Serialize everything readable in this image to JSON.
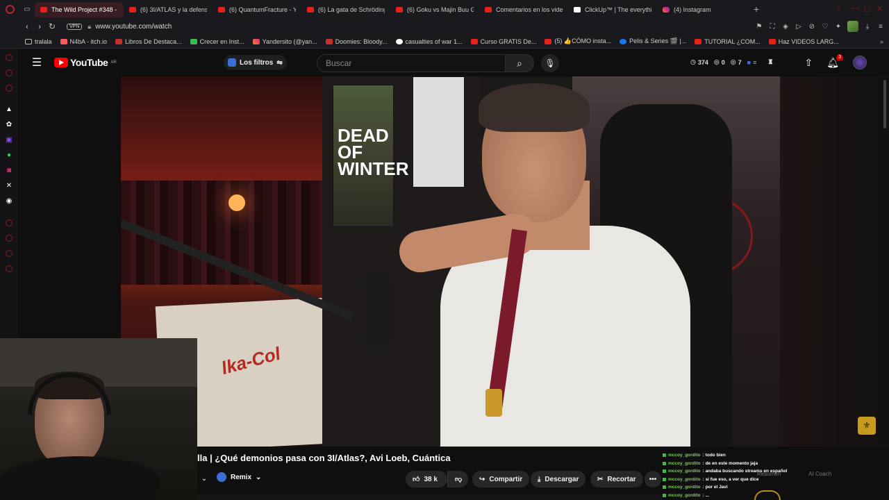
{
  "browser": {
    "tabs": [
      {
        "title": "The Wild Project #348 - J",
        "favicon": "youtube-icon",
        "active": true
      },
      {
        "title": "(6) 3I/ATLAS y la defensa",
        "favicon": "youtube-icon"
      },
      {
        "title": "(6) QuantumFracture - Yo",
        "favicon": "youtube-icon"
      },
      {
        "title": "(6) La gata de Schrödinge",
        "favicon": "youtube-icon"
      },
      {
        "title": "(6) Goku vs Majin Buu Go",
        "favicon": "youtube-icon"
      },
      {
        "title": "Comentarios en los videc",
        "favicon": "youtube-icon"
      },
      {
        "title": "ClickUp™ | The everything",
        "favicon": "clickup-icon"
      },
      {
        "title": "(4) Instagram",
        "favicon": "instagram-icon"
      }
    ],
    "new_tab": "+",
    "vpn_label": "VPN",
    "url": "www.youtube.com/watch",
    "bookmarks": [
      {
        "label": "tralala",
        "icon": "folder-icon"
      },
      {
        "label": "N4bA - itch.io",
        "icon": "itch-icon"
      },
      {
        "label": "Libros De Destaca...",
        "icon": "book-icon"
      },
      {
        "label": "Crecer en Inst...",
        "icon": "check-icon"
      },
      {
        "label": "Yandersito (@yan...",
        "icon": "instagram-icon"
      },
      {
        "label": "Doomies: Bloody...",
        "icon": "doomies-icon"
      },
      {
        "label": "casualties of war 1...",
        "icon": "google-icon"
      },
      {
        "label": "Curso GRATIS De...",
        "icon": "youtube-icon"
      },
      {
        "label": "(5) 👍CÓMO insta...",
        "icon": "youtube-icon"
      },
      {
        "label": "Pelis & Series 🎬 |...",
        "icon": "meta-icon"
      },
      {
        "label": "TUTORIAL ¿COM...",
        "icon": "youtube-icon"
      },
      {
        "label": "Haz VIDEOS LARG...",
        "icon": "youtube-icon"
      }
    ]
  },
  "youtube": {
    "logo_text": "YouTube",
    "region": "AR",
    "filters_label": "Los filtros",
    "search_placeholder": "Buscar",
    "stats": {
      "views": "374",
      "hidden": "0",
      "watchers": "7"
    },
    "notifications_count": "3",
    "video_title": "lla | ¿Qué demonios pasa con 3I/Atlas?, Avi Loeb, Cuántica",
    "remix_label": "Remix",
    "likes": "38 k",
    "share_label": "Compartir",
    "download_label": "Descargar",
    "clip_label": "Recortar",
    "video_poster_text": "DEAD OF WINTER",
    "video_sign_text": "lka-Col"
  },
  "chat": {
    "messages": [
      {
        "user": "mccoy_gordito",
        "text": ": todo bien"
      },
      {
        "user": "mccoy_gordito",
        "text": ": de en este momento jaja"
      },
      {
        "user": "mccoy_gordito",
        "text": ": andaba buscando streams en español"
      },
      {
        "user": "mccoy_gordito",
        "text": ": si fue eso, a ver que dice"
      },
      {
        "user": "mccoy_gordito",
        "text": ": por el Javi"
      },
      {
        "user": "mccoy_gordito",
        "text": ": ..."
      }
    ],
    "tab_summary": "Resumen",
    "tab_coach": "AI Coach"
  },
  "colors": {
    "youtube_red": "#ff0000",
    "opera_red": "#b3262c",
    "chat_user": "#7ecf57"
  }
}
